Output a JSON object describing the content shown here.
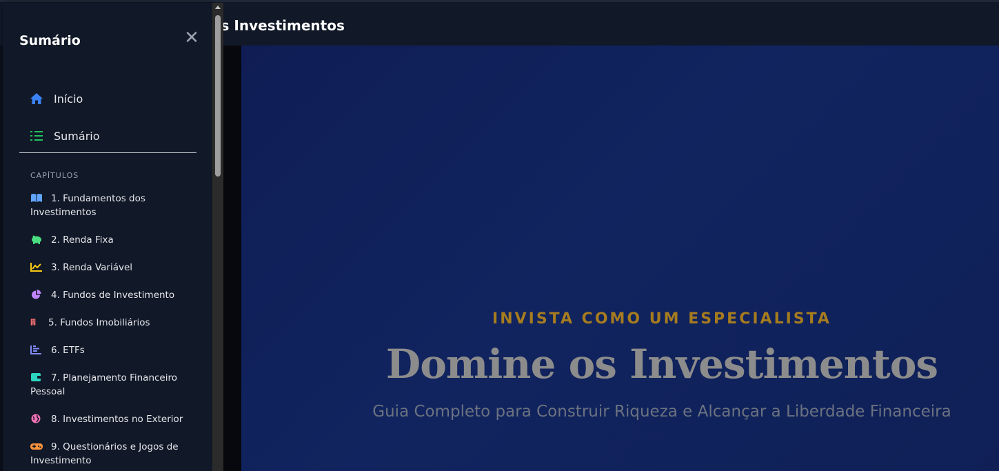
{
  "header": {
    "title": "Domine os Investimentos"
  },
  "drawer": {
    "title": "Sumário",
    "close_icon": "close-icon",
    "nav": [
      {
        "label": "Início",
        "icon": "home-icon",
        "color": "#3b82f6"
      },
      {
        "label": "Sumário",
        "icon": "list-ordered-icon",
        "color": "#22c55e"
      }
    ],
    "section_label": "CAPÍTULOS",
    "chapters": [
      {
        "label": "1. Fundamentos dos Investimentos",
        "icon": "book-open-icon",
        "color": "#60a5fa"
      },
      {
        "label": "2. Renda Fixa",
        "icon": "piggy-bank-icon",
        "color": "#4ade80"
      },
      {
        "label": "3. Renda Variável",
        "icon": "line-chart-icon",
        "color": "#facc15"
      },
      {
        "label": "4. Fundos de Investimento",
        "icon": "pie-chart-icon",
        "color": "#c084fc"
      },
      {
        "label": "5. Fundos Imobiliários",
        "icon": "building-icon",
        "color": "#f87171"
      },
      {
        "label": "6. ETFs",
        "icon": "bar-chart-icon",
        "color": "#818cf8"
      },
      {
        "label": "7. Planejamento Financeiro Pessoal",
        "icon": "wallet-icon",
        "color": "#2dd4bf"
      },
      {
        "label": "8. Investimentos no Exterior",
        "icon": "globe-icon",
        "color": "#f472b6"
      },
      {
        "label": "9. Questionários e Jogos de Investimento",
        "icon": "gamepad-icon",
        "color": "#fb923c"
      }
    ]
  },
  "hero": {
    "kicker": "INVISTA COMO UM ESPECIALISTA",
    "title": "Domine os Investimentos",
    "subtitle": "Guia Completo para Construir Riqueza e Alcançar a Liberdade Financeira"
  }
}
